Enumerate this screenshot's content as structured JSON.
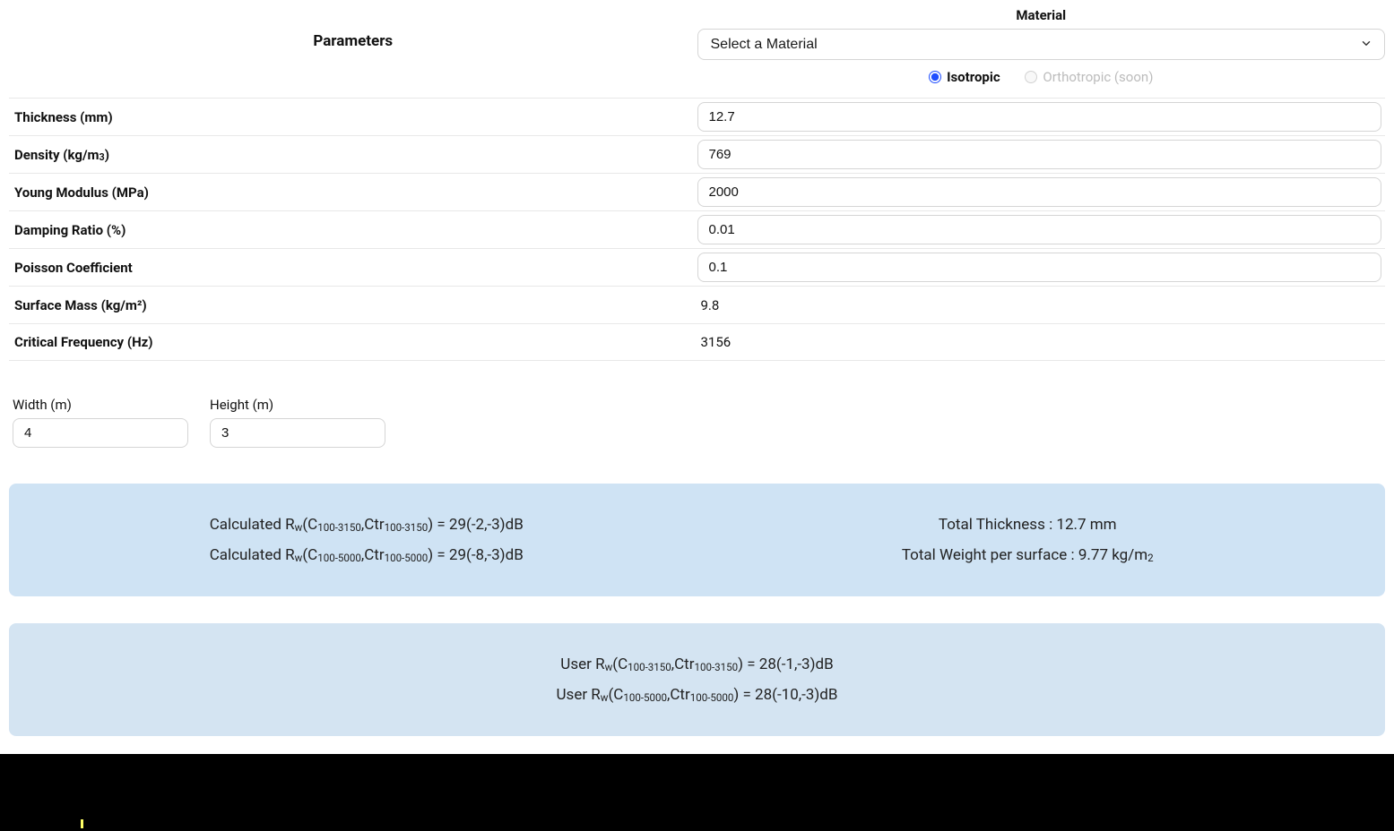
{
  "header": {
    "parameters_title": "Parameters",
    "material_title": "Material",
    "material_select_placeholder": "Select a Material",
    "isotropic_label": "Isotropic",
    "orthotropic_label": "Orthotropic (soon)"
  },
  "params": {
    "thickness": {
      "label": "Thickness (mm)",
      "value": "12.7"
    },
    "density": {
      "label": "Density (kg/m3)",
      "value": "769"
    },
    "young_modulus": {
      "label": "Young Modulus (MPa)",
      "value": "2000"
    },
    "damping_ratio": {
      "label": "Damping Ratio (%)",
      "value": "0.01"
    },
    "poisson": {
      "label": "Poisson Coefficient",
      "value": "0.1"
    },
    "surface_mass": {
      "label": "Surface Mass (kg/m²)",
      "value": "9.8"
    },
    "critical_freq": {
      "label": "Critical Frequency (Hz)",
      "value": "3156"
    }
  },
  "dimensions": {
    "width": {
      "label": "Width (m)",
      "value": "4"
    },
    "height": {
      "label": "Height (m)",
      "value": "3"
    }
  },
  "results_calc": {
    "rw_3150": {
      "prefix": "Calculated R",
      "range1": "100-3150",
      "range2": "100-3150",
      "value": " = 29(-2,-3)dB"
    },
    "rw_5000": {
      "prefix": "Calculated R",
      "range1": "100-5000",
      "range2": "100-5000",
      "value": " = 29(-8,-3)dB"
    },
    "total_thickness": "Total Thickness : 12.7 mm",
    "total_weight_prefix": "Total Weight per surface : 9.77 kg/m",
    "total_weight_exp": "2"
  },
  "results_user": {
    "rw_3150": {
      "prefix": "User R",
      "range1": "100-3150",
      "range2": "100-3150",
      "value": " = 28(-1,-3)dB"
    },
    "rw_5000": {
      "prefix": "User R",
      "range1": "100-5000",
      "range2": "100-5000",
      "value": " = 28(-10,-3)dB"
    }
  }
}
